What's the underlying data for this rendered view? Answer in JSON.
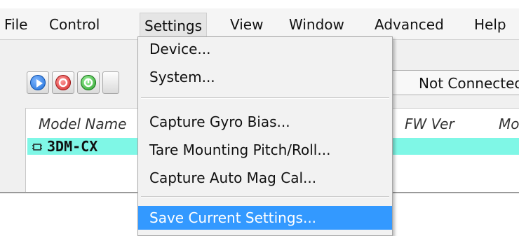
{
  "menubar": {
    "items": [
      "File",
      "Control",
      "Settings",
      "View",
      "Window",
      "Advanced",
      "Help"
    ],
    "open_menu": "Settings"
  },
  "toolbar": {
    "buttons": [
      {
        "name": "play-button",
        "icon": "play-icon",
        "color": "#1e6fd9"
      },
      {
        "name": "stop-button",
        "icon": "stop-icon",
        "color": "#d42a2a"
      },
      {
        "name": "record-button",
        "icon": "power-icon",
        "color": "#2aa12a"
      }
    ],
    "status": "Not Connected"
  },
  "device_table": {
    "headers": [
      "Model Name",
      "FW Ver",
      "Mo"
    ],
    "rows": [
      {
        "model": "3DM-CX",
        "row_color": "#7ff7e6"
      }
    ]
  },
  "settings_menu": {
    "items": [
      {
        "label": "Device...",
        "selected": false
      },
      {
        "label": "System...",
        "selected": false
      },
      {
        "separator": true
      },
      {
        "label": "Capture Gyro Bias...",
        "selected": false
      },
      {
        "label": "Tare Mounting Pitch/Roll...",
        "selected": false
      },
      {
        "label": "Capture Auto Mag Cal...",
        "selected": false
      },
      {
        "separator": true
      },
      {
        "label": "Save Current Settings...",
        "selected": true
      }
    ],
    "highlight_color": "#3399ff"
  }
}
